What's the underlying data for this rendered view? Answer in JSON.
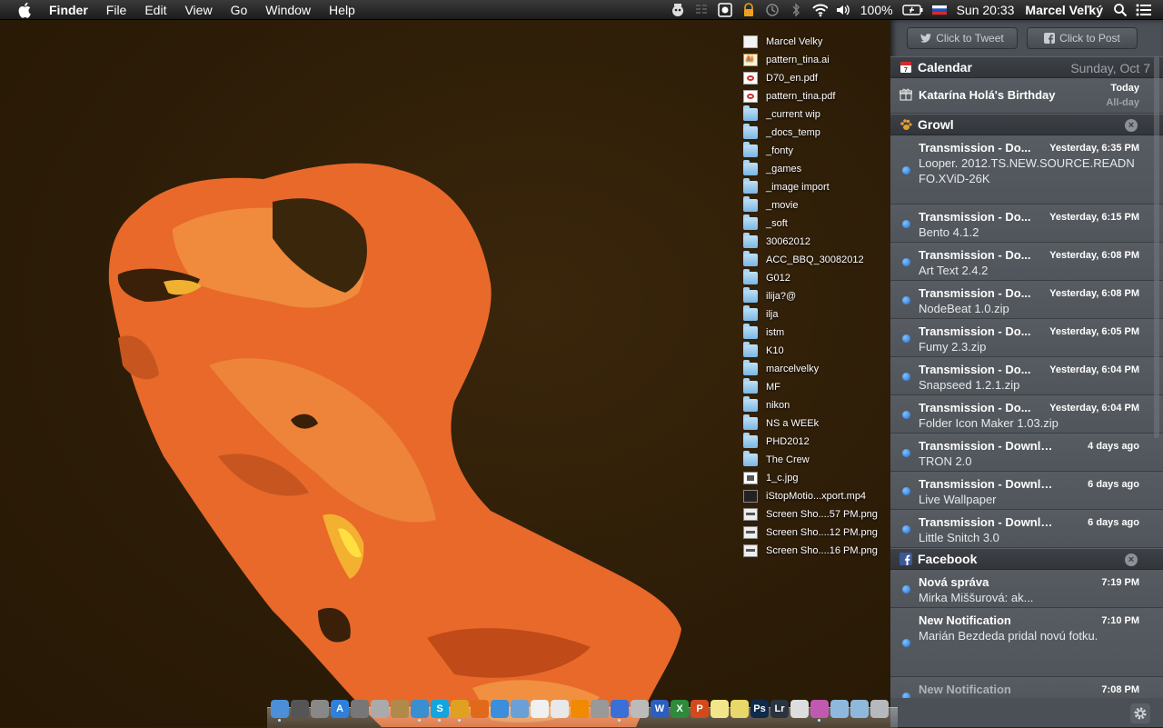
{
  "menubar": {
    "app_name": "Finder",
    "items": [
      "File",
      "Edit",
      "View",
      "Go",
      "Window",
      "Help"
    ],
    "battery": "100%",
    "clock": "Sun 20:33",
    "user": "Marcel Veľký",
    "icons": [
      "alfred-icon",
      "cpu-monitor-icon",
      "screen-record-icon",
      "lock-icon",
      "time-machine-icon",
      "bluetooth-icon",
      "wifi-icon",
      "volume-icon",
      "battery-icon",
      "flag-icon",
      "spotlight-icon",
      "notification-center-icon"
    ]
  },
  "desktop": {
    "items": [
      {
        "name": "Marcel Velky",
        "type": "doc"
      },
      {
        "name": "pattern_tina.ai",
        "type": "ai"
      },
      {
        "name": "D70_en.pdf",
        "type": "pdf"
      },
      {
        "name": "pattern_tina.pdf",
        "type": "pdf"
      },
      {
        "name": "_current wip",
        "type": "folder"
      },
      {
        "name": "_docs_temp",
        "type": "folder"
      },
      {
        "name": "_fonty",
        "type": "folder"
      },
      {
        "name": "_games",
        "type": "folder"
      },
      {
        "name": "_image import",
        "type": "folder"
      },
      {
        "name": "_movie",
        "type": "folder"
      },
      {
        "name": "_soft",
        "type": "folder"
      },
      {
        "name": "30062012",
        "type": "folder"
      },
      {
        "name": "ACC_BBQ_30082012",
        "type": "folder"
      },
      {
        "name": "G012",
        "type": "folder"
      },
      {
        "name": "ilija?@",
        "type": "folder"
      },
      {
        "name": "ilja",
        "type": "folder"
      },
      {
        "name": "istm",
        "type": "folder"
      },
      {
        "name": "K10",
        "type": "folder"
      },
      {
        "name": "marcelvelky",
        "type": "folder"
      },
      {
        "name": "MF",
        "type": "folder"
      },
      {
        "name": "nikon",
        "type": "folder"
      },
      {
        "name": "NS a WEEk",
        "type": "folder"
      },
      {
        "name": "PHD2012",
        "type": "folder"
      },
      {
        "name": "The Crew",
        "type": "folder"
      },
      {
        "name": "1_c.jpg",
        "type": "img"
      },
      {
        "name": "iStopMotio...xport.mp4",
        "type": "mov"
      },
      {
        "name": "Screen Sho....57 PM.png",
        "type": "png"
      },
      {
        "name": "Screen Sho....12 PM.png",
        "type": "png"
      },
      {
        "name": "Screen Sho....16 PM.png",
        "type": "png"
      }
    ]
  },
  "dock": {
    "apps": [
      {
        "icon": "finder-icon",
        "color": "#4a8fd8",
        "glyph": ""
      },
      {
        "icon": "dashboard-icon",
        "color": "#555",
        "glyph": ""
      },
      {
        "icon": "rocket-icon",
        "color": "#888",
        "glyph": ""
      },
      {
        "icon": "app-store-icon",
        "color": "#2f7fdc",
        "glyph": "A"
      },
      {
        "icon": "automator-icon",
        "color": "#777",
        "glyph": ""
      },
      {
        "icon": "preview-icon",
        "color": "#aaa",
        "glyph": ""
      },
      {
        "icon": "archive-icon",
        "color": "#b08a4a",
        "glyph": ""
      },
      {
        "icon": "globe-icon",
        "color": "#3a8fd0",
        "glyph": ""
      },
      {
        "icon": "skype-icon",
        "color": "#12a5e0",
        "glyph": "S"
      },
      {
        "icon": "chrome-icon",
        "color": "#e0a020",
        "glyph": ""
      },
      {
        "icon": "firefox-icon",
        "color": "#e06a1a",
        "glyph": ""
      },
      {
        "icon": "safari-icon",
        "color": "#3b8edb",
        "glyph": ""
      },
      {
        "icon": "mail-icon",
        "color": "#6aa0d8",
        "glyph": ""
      },
      {
        "icon": "calendar-icon",
        "color": "#f0f0f0",
        "glyph": ""
      },
      {
        "icon": "reminders-icon",
        "color": "#e8e8e8",
        "glyph": ""
      },
      {
        "icon": "vlc-icon",
        "color": "#f08a00",
        "glyph": ""
      },
      {
        "icon": "photo-booth-icon",
        "color": "#999",
        "glyph": ""
      },
      {
        "icon": "itunes-icon",
        "color": "#3b6fd8",
        "glyph": ""
      },
      {
        "icon": "contacts-icon",
        "color": "#bbb",
        "glyph": ""
      },
      {
        "icon": "word-icon",
        "color": "#2b5fbd",
        "glyph": "W"
      },
      {
        "icon": "excel-icon",
        "color": "#2e8b3a",
        "glyph": "X"
      },
      {
        "icon": "powerpoint-icon",
        "color": "#d24a1c",
        "glyph": "P"
      },
      {
        "icon": "notes-icon",
        "color": "#f2e68a",
        "glyph": ""
      },
      {
        "icon": "stickies-icon",
        "color": "#e8d86a",
        "glyph": ""
      },
      {
        "icon": "photoshop-icon",
        "color": "#0f2a4a",
        "glyph": "Ps"
      },
      {
        "icon": "lightroom-icon",
        "color": "#2a3440",
        "glyph": "Lr"
      },
      {
        "icon": "cinema-icon",
        "color": "#ddd",
        "glyph": ""
      },
      {
        "icon": "pinwheel-icon",
        "color": "#c05ab0",
        "glyph": ""
      },
      {
        "icon": "applications-folder-icon",
        "color": "#8fb9dc",
        "glyph": ""
      },
      {
        "icon": "downloads-folder-icon",
        "color": "#8fb9dc",
        "glyph": ""
      },
      {
        "icon": "trash-icon",
        "color": "#b5b8bc",
        "glyph": ""
      }
    ]
  },
  "nc": {
    "share": {
      "tweet": "Click to Tweet",
      "post": "Click to Post"
    },
    "calendar": {
      "header": "Calendar",
      "date": "Sunday, Oct 7",
      "event": {
        "title": "Katarína Holá's Birthday",
        "when": "Today",
        "sub": "All-day"
      }
    },
    "growl": {
      "header": "Growl",
      "items": [
        {
          "title": "Transmission - Do...",
          "time": "Yesterday, 6:35 PM",
          "body": "Looper. 2012.TS.NEW.SOURCE.READNFO.XViD-26K"
        },
        {
          "title": "Transmission - Do...",
          "time": "Yesterday, 6:15 PM",
          "body": "Bento 4.1.2"
        },
        {
          "title": "Transmission - Do...",
          "time": "Yesterday, 6:08 PM",
          "body": "Art Text 2.4.2"
        },
        {
          "title": "Transmission - Do...",
          "time": "Yesterday, 6:08 PM",
          "body": "NodeBeat 1.0.zip"
        },
        {
          "title": "Transmission - Do...",
          "time": "Yesterday, 6:05 PM",
          "body": "Fumy 2.3.zip"
        },
        {
          "title": "Transmission - Do...",
          "time": "Yesterday, 6:04 PM",
          "body": "Snapseed 1.2.1.zip"
        },
        {
          "title": "Transmission - Do...",
          "time": "Yesterday, 6:04 PM",
          "body": "Folder Icon Maker 1.03.zip"
        },
        {
          "title": "Transmission - Download...",
          "time": "4 days ago",
          "body": "TRON 2.0"
        },
        {
          "title": "Transmission - Download...",
          "time": "6 days ago",
          "body": "Live Wallpaper"
        },
        {
          "title": "Transmission - Download...",
          "time": "6 days ago",
          "body": "Little Snitch 3.0"
        }
      ]
    },
    "facebook": {
      "header": "Facebook",
      "items": [
        {
          "title": "Nová správa",
          "time": "7:19 PM",
          "body": "Mirka Miššurová: ak..."
        },
        {
          "title": "New Notification",
          "time": "7:10 PM",
          "body": "Marián Bezdeda pridal novú fotku."
        },
        {
          "title": "New Notification",
          "time": "7:08 PM",
          "body": ""
        }
      ]
    }
  }
}
